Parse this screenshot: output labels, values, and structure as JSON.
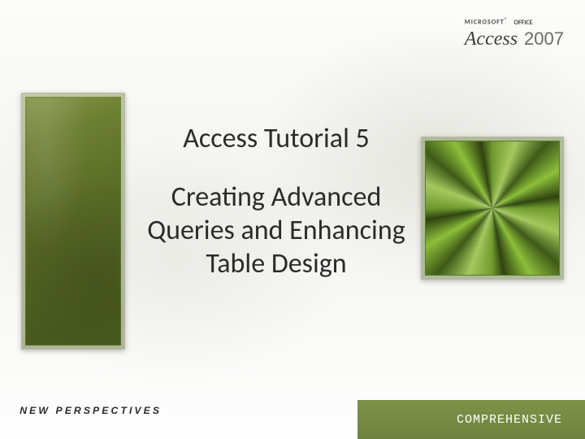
{
  "brand": {
    "microsoft": "MICROSOFT",
    "office": "OFFICE",
    "product": "Access",
    "year": "2007"
  },
  "title": {
    "heading": "Access Tutorial 5",
    "subheading": "Creating Advanced Queries and Enhancing Table Design"
  },
  "series": {
    "name": "NEW PERSPECTIVES",
    "edition": "COMPREHENSIVE"
  },
  "colors": {
    "olive": "#6f8340",
    "olive_dark": "#4a5a1e",
    "text": "#2b2b2b"
  }
}
